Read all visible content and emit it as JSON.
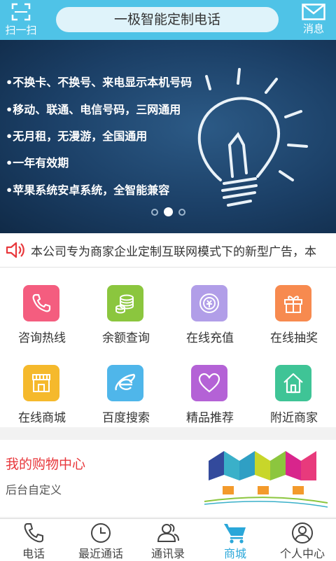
{
  "header": {
    "scan_label": "扫一扫",
    "title": "一极智能定制电话",
    "message_label": "消息"
  },
  "banner": {
    "lines": [
      "•不换卡、不换号、来电显示本机号码",
      "•移动、联通、电信号码，三网通用",
      "•无月租，无漫游，全国通用",
      "•一年有效期",
      "•苹果系统安卓系统，全智能兼容"
    ],
    "active_slide": 2,
    "slide_count": 3
  },
  "notice": {
    "text": "本公司专为商家企业定制互联网模式下的新型广告，本"
  },
  "grid": {
    "items": [
      {
        "label": "咨询热线",
        "color": "#f45d7f",
        "icon": "phone-icon"
      },
      {
        "label": "余额查询",
        "color": "#8bc63e",
        "icon": "coins-icon"
      },
      {
        "label": "在线充值",
        "color": "#b19ee8",
        "icon": "coin-icon"
      },
      {
        "label": "在线抽奖",
        "color": "#f78a4f",
        "icon": "gift-icon"
      },
      {
        "label": "在线商城",
        "color": "#f5b92c",
        "icon": "store-icon"
      },
      {
        "label": "百度搜索",
        "color": "#4fb6ea",
        "icon": "browser-icon"
      },
      {
        "label": "精品推荐",
        "color": "#b462d6",
        "icon": "heart-icon"
      },
      {
        "label": "附近商家",
        "color": "#3fc496",
        "icon": "home-icon"
      }
    ]
  },
  "shop": {
    "title": "我的购物中心",
    "subtitle": "后台自定义"
  },
  "nav": {
    "items": [
      {
        "label": "电话",
        "icon": "phone-icon"
      },
      {
        "label": "最近通话",
        "icon": "clock-icon"
      },
      {
        "label": "通讯录",
        "icon": "contacts-icon"
      },
      {
        "label": "商城",
        "icon": "cart-icon"
      },
      {
        "label": "个人中心",
        "icon": "user-icon"
      }
    ],
    "active": "商城"
  },
  "colors": {
    "header_bg": "#4fc3e7",
    "active_nav": "#2aa7d9",
    "shop_title": "#e8383c"
  }
}
